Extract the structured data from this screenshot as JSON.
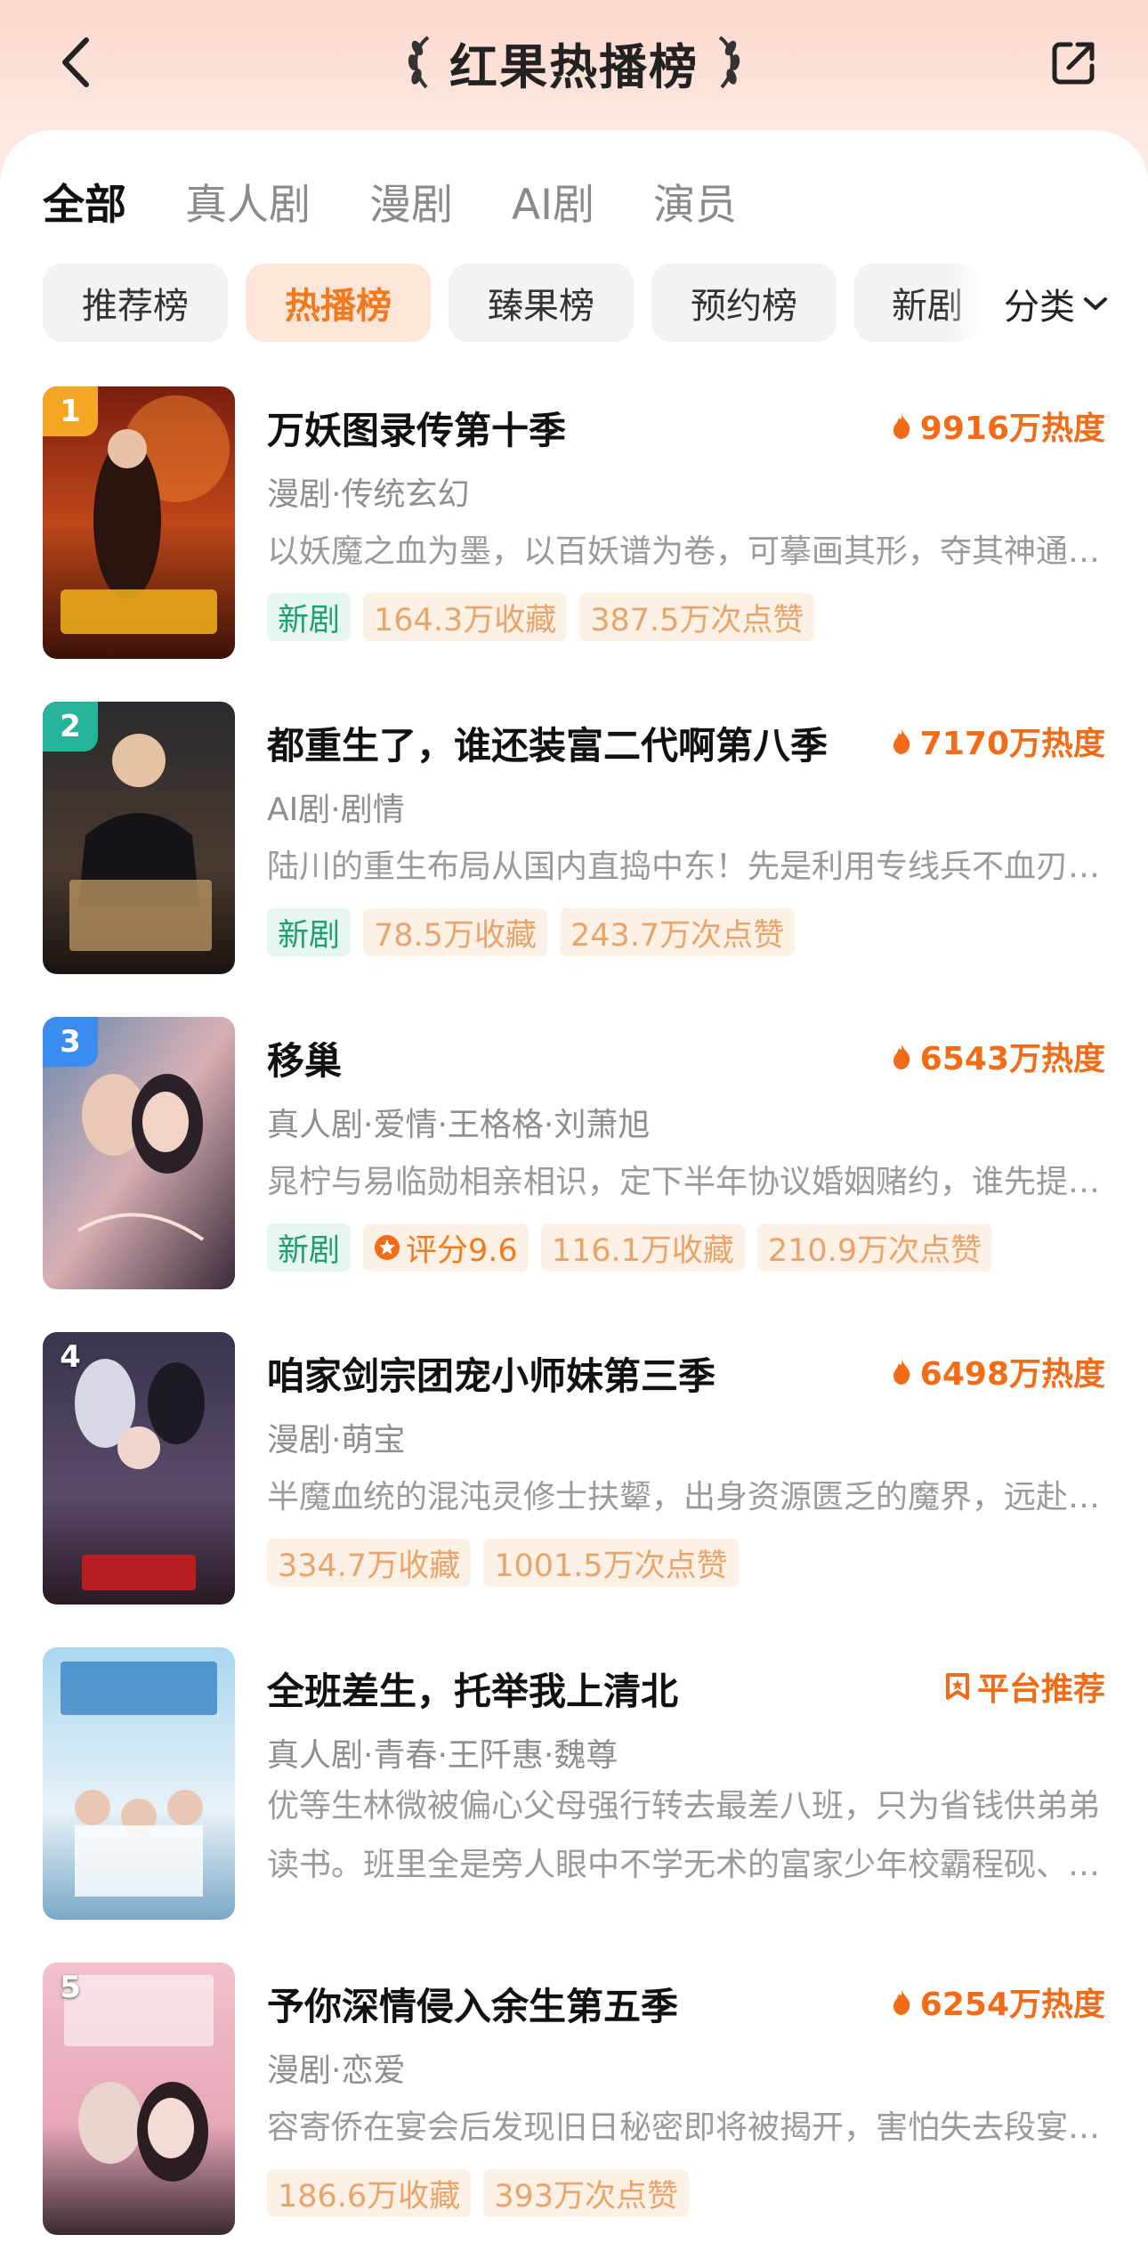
{
  "header": {
    "title": "红果热播榜"
  },
  "tabs": [
    {
      "label": "全部",
      "active": true
    },
    {
      "label": "真人剧",
      "active": false
    },
    {
      "label": "漫剧",
      "active": false
    },
    {
      "label": "AI剧",
      "active": false
    },
    {
      "label": "演员",
      "active": false
    }
  ],
  "chips": [
    {
      "label": "推荐榜",
      "active": false
    },
    {
      "label": "热播榜",
      "active": true
    },
    {
      "label": "臻果榜",
      "active": false
    },
    {
      "label": "预约榜",
      "active": false
    },
    {
      "label": "新剧",
      "active": false
    }
  ],
  "category_label": "分类",
  "items": [
    {
      "rank": "1",
      "title": "万妖图录传第十季",
      "heat": "9916万热度",
      "meta": "漫剧·传统玄幻",
      "desc": "以妖魔之血为墨，以百妖谱为卷，可摹画其形，夺其神通…",
      "tags": [
        "新剧",
        "164.3万收藏",
        "387.5万次点赞"
      ]
    },
    {
      "rank": "2",
      "title": "都重生了，谁还装富二代啊第八季",
      "heat": "7170万热度",
      "meta": "AI剧·剧情",
      "desc": "陆川的重生布局从国内直捣中东！先是利用专线兵不血刃…",
      "tags": [
        "新剧",
        "78.5万收藏",
        "243.7万次点赞"
      ]
    },
    {
      "rank": "3",
      "title": "移巢",
      "heat": "6543万热度",
      "meta": "真人剧·爱情·王格格·刘萧旭",
      "desc": "晁柠与易临勋相亲相识，定下半年协议婚姻赌约，谁先提…",
      "tags": [
        "新剧",
        "评分9.6",
        "116.1万收藏",
        "210.9万次点赞"
      ]
    },
    {
      "rank": "4",
      "title": "咱家剑宗团宠小师妹第三季",
      "heat": "6498万热度",
      "meta": "漫剧·萌宝",
      "desc": "半魔血统的混沌灵修士扶颦，出身资源匮乏的魔界，远赴…",
      "tags": [
        "334.7万收藏",
        "1001.5万次点赞"
      ]
    },
    {
      "rank": "",
      "title": "全班差生，托举我上清北",
      "heat": "平台推荐",
      "meta": "真人剧·青春·王阡惠·魏尊",
      "desc": "优等生林微被偏心父母强行转去最差八班，只为省钱供弟弟读书。班里全是旁人眼中不学无术的富家少年校霸程砚、…",
      "tags": []
    },
    {
      "rank": "5",
      "title": "予你深情侵入余生第五季",
      "heat": "6254万热度",
      "meta": "漫剧·恋爱",
      "desc": "容寄侨在宴会后发现旧日秘密即将被揭开，害怕失去段宴…",
      "tags": [
        "186.6万收藏",
        "393万次点赞"
      ]
    }
  ],
  "colors": {
    "accent_orange": "#f36b16",
    "rank1": "#f5a623",
    "rank2": "#26b39a",
    "rank3": "#3b8cf0"
  }
}
